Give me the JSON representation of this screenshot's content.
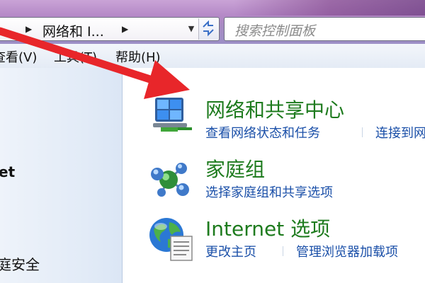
{
  "address_bar": {
    "breadcrumb": "网络和 I...",
    "search_placeholder": "搜索控制面板"
  },
  "menu": {
    "view": "查看(V)",
    "tools": "工具(T)",
    "help": "帮助(H)"
  },
  "left_pane": {
    "items": [
      "et",
      "庭安全"
    ]
  },
  "categories": [
    {
      "title": "网络和共享中心",
      "links": [
        "查看网络状态和任务",
        "连接到网"
      ],
      "icon": "network-sharing-center-icon"
    },
    {
      "title": "家庭组",
      "links": [
        "选择家庭组和共享选项"
      ],
      "icon": "homegroup-icon"
    },
    {
      "title": "Internet 选项",
      "links": [
        "更改主页",
        "管理浏览器加载项"
      ],
      "icon": "internet-options-icon"
    }
  ],
  "colors": {
    "category_title": "#1e7b1e",
    "link": "#1a4fa8",
    "annotation_arrow": "#e8262a"
  }
}
